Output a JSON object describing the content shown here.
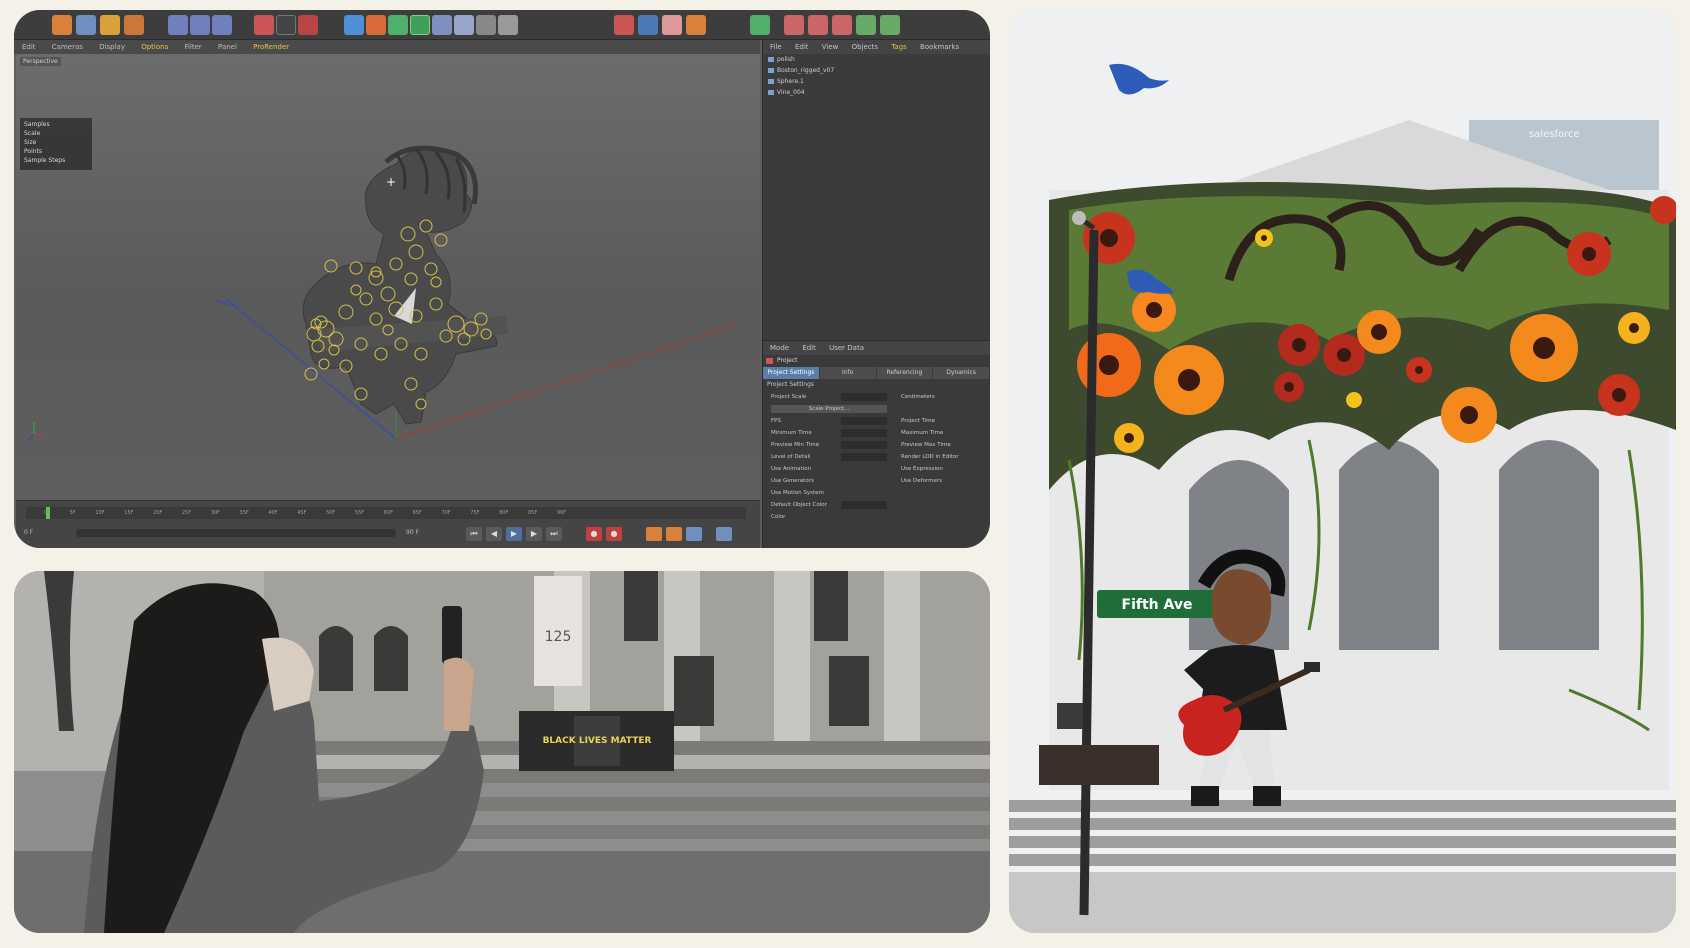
{
  "c4d": {
    "menu": [
      "Edit",
      "Cameras",
      "Display",
      "Options",
      "Filter",
      "Panel",
      "ProRender"
    ],
    "viewport_label": "Perspective",
    "hud": [
      "Samples",
      "Scale",
      "Size",
      "Points",
      "Sample Steps"
    ],
    "object_manager": {
      "menu": [
        "File",
        "Edit",
        "View",
        "Objects",
        "Tags",
        "Bookmarks"
      ],
      "objects": [
        "polish",
        "Boston_rigged_v07",
        "Sphere.1",
        "Vine_004"
      ]
    },
    "attribute_manager": {
      "menu": [
        "Mode",
        "Edit",
        "User Data"
      ],
      "title": "Project",
      "tabs": [
        "Project Settings",
        "Info",
        "Referencing",
        "Dynamics"
      ],
      "section": "Project Settings",
      "rows": [
        {
          "label": "Project Scale",
          "right": "Centimeters"
        },
        {
          "label": "Scale Project...",
          "right": ""
        },
        {
          "label": "FPS",
          "right": "Project Time"
        },
        {
          "label": "Minimum Time",
          "right": "Maximum Time"
        },
        {
          "label": "Preview Min Time",
          "right": "Preview Max Time"
        },
        {
          "label": "Level of Detail",
          "right": "Render LOD in Editor"
        },
        {
          "label": "Use Animation",
          "right": "Use Expression"
        },
        {
          "label": "Use Generators",
          "right": "Use Deformers"
        },
        {
          "label": "Use Motion System",
          "right": ""
        },
        {
          "label": "Default Object Color",
          "right": ""
        },
        {
          "label": "Color",
          "right": ""
        }
      ]
    },
    "timeline": {
      "ticks": [
        "0F",
        "5F",
        "10F",
        "15F",
        "20F",
        "25F",
        "30F",
        "35F",
        "40F",
        "45F",
        "50F",
        "55F",
        "60F",
        "65F",
        "70F",
        "75F",
        "80F",
        "85F",
        "90F"
      ],
      "start": "0 F",
      "end": "90 F"
    }
  },
  "photo": {
    "sign_text": "BLACK LIVES MATTER",
    "banner_text": "125"
  },
  "ar": {
    "street_sign": "Fifth Ave",
    "building_sign": "salesforce"
  }
}
